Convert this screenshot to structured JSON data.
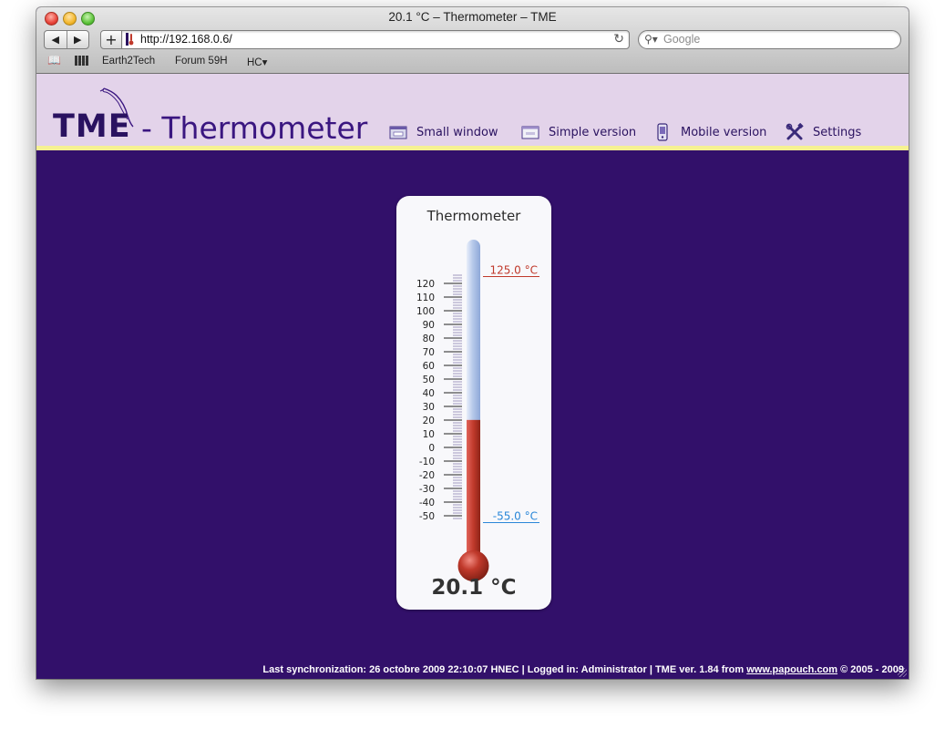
{
  "browser": {
    "window_title": "20.1 °C – Thermometer – TME",
    "url": "http://192.168.0.6/",
    "search_placeholder": "Google",
    "bookmarks": [
      "Earth2Tech",
      "Forum 59H",
      "HC▾"
    ]
  },
  "header": {
    "logo": "TME",
    "title": "- Thermometer",
    "menu": [
      {
        "label": "Small window",
        "icon": "small-window-icon"
      },
      {
        "label": "Simple version",
        "icon": "simple-version-icon"
      },
      {
        "label": "Mobile version",
        "icon": "mobile-icon"
      },
      {
        "label": "Settings",
        "icon": "settings-tools-icon"
      }
    ]
  },
  "thermometer": {
    "title": "Thermometer",
    "value": 20.1,
    "reading": "20.1 °C",
    "scale_min": -50,
    "scale_max": 120,
    "scale_step": 10,
    "scale_labels": [
      "120",
      "110",
      "100",
      "90",
      "80",
      "70",
      "60",
      "50",
      "40",
      "30",
      "20",
      "10",
      "0",
      "-10",
      "-20",
      "-30",
      "-40",
      "-50"
    ],
    "max_limit": 125.0,
    "max_limit_label": "125.0 °C",
    "min_limit": -55.0,
    "min_limit_label": "-55.0 °C",
    "colors": {
      "mercury": "#c0392b",
      "tube": "#bcd0ee",
      "max_limit": "#c0392b",
      "min_limit": "#2a87d8"
    }
  },
  "footer": {
    "text": "Last synchronization: 26 octobre 2009 22:10:07 HNEC | Logged in: Administrator | TME ver. 1.84 from ",
    "link": "www.papouch.com",
    "copyright": " © 2005 - 2009"
  }
}
